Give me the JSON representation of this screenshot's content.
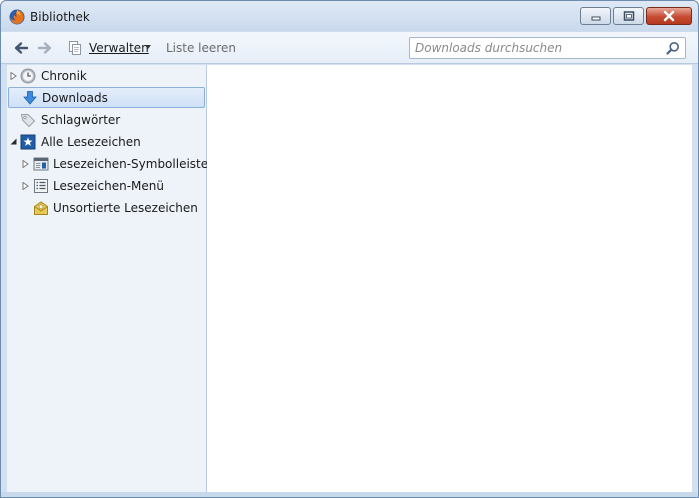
{
  "window": {
    "title": "Bibliothek",
    "icon": "firefox-icon"
  },
  "titlebar_buttons": [
    "minimize-icon",
    "maximize-icon",
    "close-icon"
  ],
  "toolbar": {
    "back_icon": "back-arrow-icon",
    "forward_icon": "forward-arrow-icon",
    "organize_label": "Verwalten",
    "clear_label": "Liste leeren",
    "search_placeholder": "Downloads durchsuchen"
  },
  "sidebar": {
    "items": [
      {
        "label": "Chronik",
        "icon": "clock-icon",
        "expandable": true,
        "selected": false
      },
      {
        "label": "Downloads",
        "icon": "download-arrow-icon",
        "expandable": false,
        "selected": true
      },
      {
        "label": "Schlagwörter",
        "icon": "tag-icon",
        "expandable": false,
        "selected": false
      },
      {
        "label": "Alle Lesezeichen",
        "icon": "bookmarks-star-icon",
        "expandable": true,
        "expanded": true,
        "selected": false
      },
      {
        "label": "Lesezeichen-Symbolleiste",
        "icon": "bookmarks-toolbar-icon",
        "expandable": true,
        "selected": false
      },
      {
        "label": "Lesezeichen-Menü",
        "icon": "bookmarks-menu-icon",
        "expandable": true,
        "selected": false
      },
      {
        "label": "Unsortierte Lesezeichen",
        "icon": "unsorted-bookmarks-icon",
        "expandable": false,
        "selected": false
      }
    ]
  },
  "colors": {
    "titlebar": "#c9d9ec",
    "selection": "#cfe0f6",
    "selection_border": "#8bb0dc",
    "close_button": "#c54c32"
  }
}
